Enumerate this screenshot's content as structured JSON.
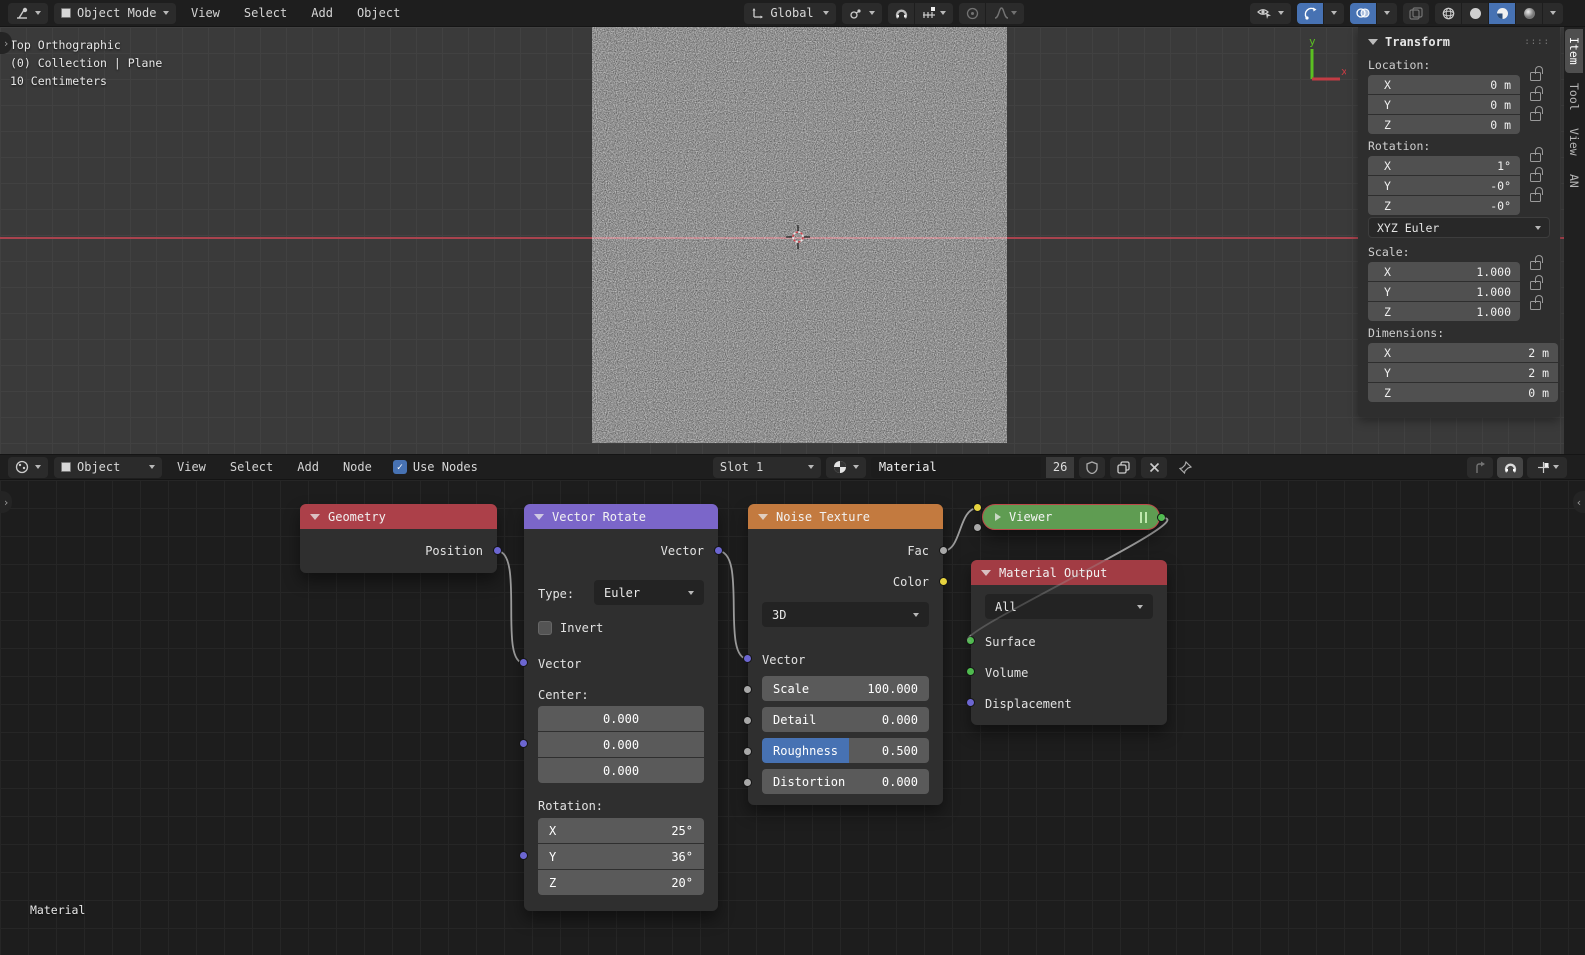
{
  "colors": {
    "accent": "#4772b3",
    "axis_x_red": "#a8434e",
    "header_geometry": "#ac4049",
    "header_vector_rotate": "#7b66c9",
    "header_noise_texture": "#c37a3f",
    "header_material_output": "#a23c44",
    "viewer_green": "#5f9c52",
    "socket_vector": "#6c66d1",
    "socket_gray": "#a8a8a8",
    "socket_yellow": "#e6d33f",
    "socket_green": "#4fbb4f"
  },
  "viewport": {
    "header": {
      "mode": "Object Mode",
      "menus": [
        "View",
        "Select",
        "Add",
        "Object"
      ],
      "orientation": "Global"
    },
    "overlay": {
      "line1": "Top Orthographic",
      "line2": "(0) Collection | Plane",
      "line3": "10 Centimeters"
    },
    "axis": {
      "x": "x",
      "y": "y"
    },
    "sidebar": {
      "title": "Transform",
      "tabs": [
        "Item",
        "Tool",
        "View",
        "AN"
      ],
      "location": {
        "label": "Location:",
        "rows": [
          [
            "X",
            "0 m"
          ],
          [
            "Y",
            "0 m"
          ],
          [
            "Z",
            "0 m"
          ]
        ]
      },
      "rotation": {
        "label": "Rotation:",
        "rows": [
          [
            "X",
            "1°"
          ],
          [
            "Y",
            "-0°"
          ],
          [
            "Z",
            "-0°"
          ]
        ]
      },
      "rotation_mode": "XYZ Euler",
      "scale": {
        "label": "Scale:",
        "rows": [
          [
            "X",
            "1.000"
          ],
          [
            "Y",
            "1.000"
          ],
          [
            "Z",
            "1.000"
          ]
        ]
      },
      "dimensions": {
        "label": "Dimensions:",
        "rows": [
          [
            "X",
            "2 m"
          ],
          [
            "Y",
            "2 m"
          ],
          [
            "Z",
            "0 m"
          ]
        ]
      }
    }
  },
  "node_editor": {
    "header": {
      "mode": "Object",
      "menus": [
        "View",
        "Select",
        "Add",
        "Node"
      ],
      "use_nodes": "Use Nodes",
      "slot": "Slot 1",
      "material_name": "Material",
      "users": "26"
    },
    "material_overlay": "Material",
    "nodes": {
      "geometry": {
        "title": "Geometry",
        "output": "Position"
      },
      "vector_rotate": {
        "title": "Vector Rotate",
        "output": "Vector",
        "type_label": "Type:",
        "type_value": "Euler",
        "invert_label": "Invert",
        "input": "Vector",
        "center_label": "Center:",
        "center": [
          "0.000",
          "0.000",
          "0.000"
        ],
        "rotation_label": "Rotation:",
        "rotation": [
          [
            "X",
            "25°"
          ],
          [
            "Y",
            "36°"
          ],
          [
            "Z",
            "20°"
          ]
        ]
      },
      "noise_texture": {
        "title": "Noise Texture",
        "out_fac": "Fac",
        "out_color": "Color",
        "dimensions": "3D",
        "input": "Vector",
        "params": [
          [
            "Scale",
            "100.000"
          ],
          [
            "Detail",
            "0.000"
          ],
          [
            "Roughness",
            "0.500"
          ],
          [
            "Distortion",
            "0.000"
          ]
        ]
      },
      "viewer": {
        "title": "Viewer"
      },
      "material_output": {
        "title": "Material Output",
        "target": "All",
        "inputs": [
          "Surface",
          "Volume",
          "Displacement"
        ]
      }
    }
  }
}
